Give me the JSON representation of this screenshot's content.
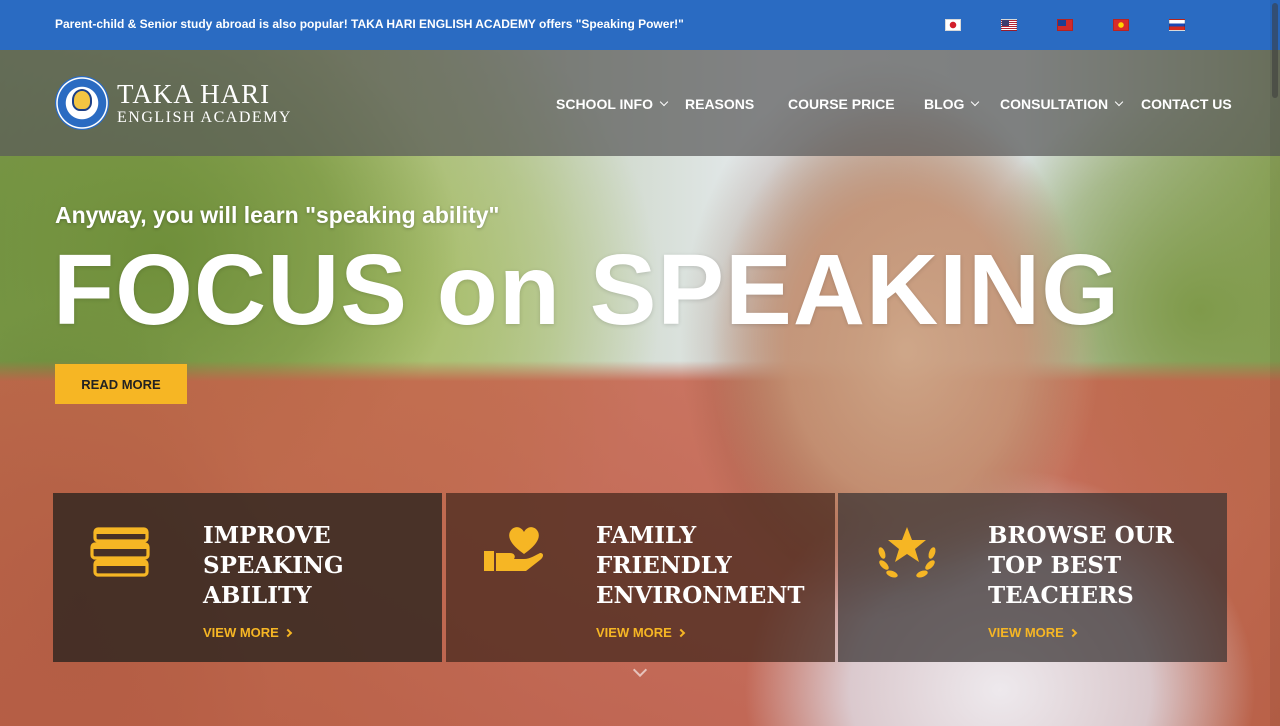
{
  "topbar": {
    "notice": "Parent-child & Senior study abroad is also popular! TAKA HARI ENGLISH ACADEMY offers \"Speaking Power!\"",
    "languages": [
      "japanese-flag",
      "us-flag",
      "taiwan-flag",
      "vietnam-flag",
      "russia-flag"
    ]
  },
  "logo": {
    "line1": "TAKA HARI",
    "line2": "ENGLISH ACADEMY"
  },
  "nav": {
    "items": [
      {
        "label": "SCHOOL INFO",
        "has_dropdown": true
      },
      {
        "label": "REASONS",
        "has_dropdown": false
      },
      {
        "label": "COURSE PRICE",
        "has_dropdown": false
      },
      {
        "label": "BLOG",
        "has_dropdown": true
      },
      {
        "label": "CONSULTATION",
        "has_dropdown": true
      },
      {
        "label": "CONTACT US",
        "has_dropdown": false
      }
    ]
  },
  "hero": {
    "subtitle": "Anyway, you will learn \"speaking ability\"",
    "title": "FOCUS on SPEAKING",
    "cta": "READ MORE"
  },
  "cards": [
    {
      "icon": "books-icon",
      "title_lines": [
        "IMPROVE",
        "SPEAKING",
        "ABILITY"
      ],
      "link": "VIEW MORE"
    },
    {
      "icon": "hand-heart-icon",
      "title_lines": [
        "FAMILY",
        "FRIENDLY",
        "ENVIRONMENT"
      ],
      "link": "VIEW MORE"
    },
    {
      "icon": "star-laurel-icon",
      "title_lines": [
        "BROWSE OUR",
        "TOP BEST",
        "TEACHERS"
      ],
      "link": "VIEW MORE"
    }
  ],
  "colors": {
    "topbar": "#2a6bc2",
    "accent": "#f6b624",
    "text_light": "#ffffff"
  }
}
